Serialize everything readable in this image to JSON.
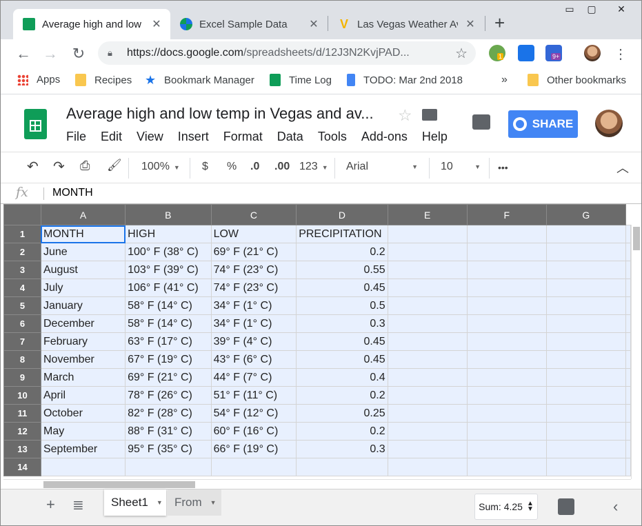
{
  "browser": {
    "tabs": [
      {
        "title": "Average high and low temp in Vegas and average precipitation",
        "favicon": "sheets-icon",
        "close": "✕"
      },
      {
        "title": "Excel Sample Data",
        "favicon": "puzzle-icon",
        "close": "✕"
      },
      {
        "title": "Las Vegas Weather Averages",
        "favicon": "weather-v-icon",
        "close": "✕"
      }
    ],
    "new_tab": "+",
    "window_controls": {
      "minimize": "▭",
      "maximize": "▢",
      "close": "✕"
    },
    "url_host": "https://docs.google.com",
    "url_path": "/spreadsheets/d/12J3N2KvjPAD...",
    "extensions": [
      {
        "name": "extension-icon-1",
        "badge": "1",
        "color": "#6aa84f",
        "badge_color": "#f4b400"
      },
      {
        "name": "extension-icon-2",
        "badge": "",
        "color": "#1a73e8",
        "badge_color": ""
      },
      {
        "name": "extension-icon-3",
        "badge": "9+",
        "color": "#3367d6",
        "badge_color": "#8e44ad"
      }
    ],
    "bookmarks": [
      {
        "label": "Apps",
        "icon": "apps-grid-icon"
      },
      {
        "label": "Recipes",
        "icon": "folder-icon"
      },
      {
        "label": "Bookmark Manager",
        "icon": "star-icon"
      },
      {
        "label": "Time Log",
        "icon": "sheets-icon"
      },
      {
        "label": "TODO: Mar 2nd 2018",
        "icon": "docs-icon"
      }
    ],
    "bookmarks_overflow": "»",
    "other_bookmarks": "Other bookmarks"
  },
  "doc": {
    "title": "Average high and low temp in Vegas and av...",
    "menu": [
      "File",
      "Edit",
      "View",
      "Insert",
      "Format",
      "Data",
      "Tools",
      "Add-ons",
      "Help"
    ],
    "share_label": "SHARE",
    "accent": "#4285f4",
    "brand_green": "#0f9d58"
  },
  "format_toolbar": {
    "zoom": "100%",
    "currency": "$",
    "percent": "%",
    "decrease_decimal": ".0",
    "increase_decimal": ".00",
    "more_formats": "123",
    "font": "Arial",
    "font_size": "10",
    "more": "•••"
  },
  "formula_bar": {
    "fx": "fx",
    "value": "MONTH"
  },
  "grid": {
    "columns": [
      "A",
      "B",
      "C",
      "D",
      "E",
      "F",
      "G"
    ],
    "rows": [
      {
        "n": "1",
        "cells": [
          "MONTH",
          "HIGH",
          "LOW",
          "PRECIPITATION",
          "",
          "",
          ""
        ]
      },
      {
        "n": "2",
        "cells": [
          "June",
          "100° F (38° C)",
          "69° F (21° C)",
          "0.2",
          "",
          "",
          ""
        ]
      },
      {
        "n": "3",
        "cells": [
          "August",
          "103° F (39° C)",
          "74° F (23° C)",
          "0.55",
          "",
          "",
          ""
        ]
      },
      {
        "n": "4",
        "cells": [
          "July",
          "106° F (41° C)",
          "74° F (23° C)",
          "0.45",
          "",
          "",
          ""
        ]
      },
      {
        "n": "5",
        "cells": [
          "January",
          "58° F (14° C)",
          "34° F (1° C)",
          "0.5",
          "",
          "",
          ""
        ]
      },
      {
        "n": "6",
        "cells": [
          "December",
          "58° F (14° C)",
          "34° F (1° C)",
          "0.3",
          "",
          "",
          ""
        ]
      },
      {
        "n": "7",
        "cells": [
          "February",
          "63° F (17° C)",
          "39° F (4° C)",
          "0.45",
          "",
          "",
          ""
        ]
      },
      {
        "n": "8",
        "cells": [
          "November",
          "67° F (19° C)",
          "43° F (6° C)",
          "0.45",
          "",
          "",
          ""
        ]
      },
      {
        "n": "9",
        "cells": [
          "March",
          "69° F (21° C)",
          "44° F (7° C)",
          "0.4",
          "",
          "",
          ""
        ]
      },
      {
        "n": "10",
        "cells": [
          "April",
          "78° F (26° C)",
          "51° F (11° C)",
          "0.2",
          "",
          "",
          ""
        ]
      },
      {
        "n": "11",
        "cells": [
          "October",
          "82° F (28° C)",
          "54° F (12° C)",
          "0.25",
          "",
          "",
          ""
        ]
      },
      {
        "n": "12",
        "cells": [
          "May",
          "88° F (31° C)",
          "60° F (16° C)",
          "0.2",
          "",
          "",
          ""
        ]
      },
      {
        "n": "13",
        "cells": [
          "September",
          "95° F (35° C)",
          "66° F (19° C)",
          "0.3",
          "",
          "",
          ""
        ]
      },
      {
        "n": "14",
        "cells": [
          "",
          "",
          "",
          "",
          "",
          "",
          ""
        ]
      }
    ]
  },
  "bottom": {
    "add_sheet": "+",
    "all_sheets": "≣",
    "sheets": [
      {
        "label": "Sheet1",
        "active": true
      },
      {
        "label": "From",
        "active": false
      }
    ],
    "sum": "Sum: 4.25",
    "collapse": "‹"
  }
}
